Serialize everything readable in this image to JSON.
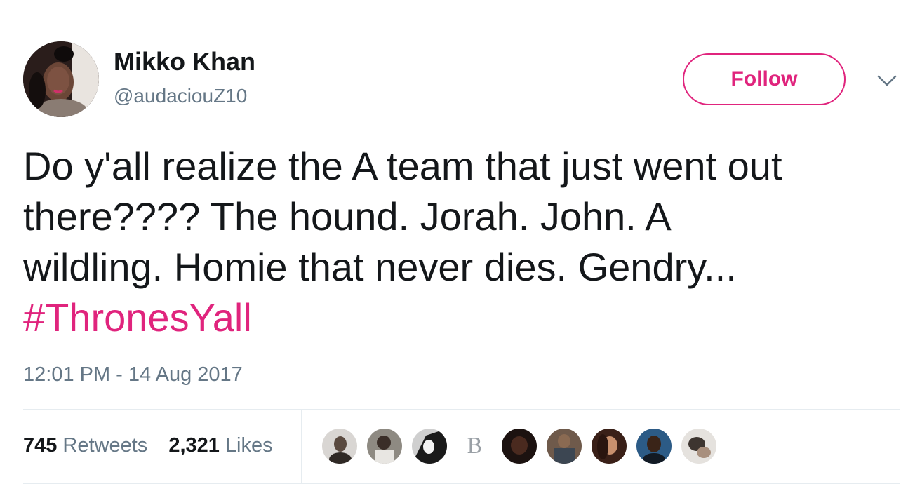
{
  "author": {
    "display_name": "Mikko Khan",
    "handle": "@audaciouZ10"
  },
  "follow_button": {
    "label": "Follow"
  },
  "tweet": {
    "lines": [
      "Do y'all realize the A team that just went out",
      "there???? The hound. Jorah. John. A",
      "wildling. Homie that never dies. Gendry..."
    ],
    "hashtag": "#ThronesYall",
    "timestamp": "12:01 PM - 14 Aug 2017"
  },
  "stats": {
    "retweets_count": "745",
    "retweets_label": "Retweets",
    "likes_count": "2,321",
    "likes_label": "Likes"
  },
  "liker_avatars_letter": "B",
  "colors": {
    "accent": "#e0247d",
    "text_primary": "#14171a",
    "text_secondary": "#657786",
    "divider": "#e6ecf0"
  },
  "icons": {
    "menu_caret": "chevron-down-icon"
  }
}
